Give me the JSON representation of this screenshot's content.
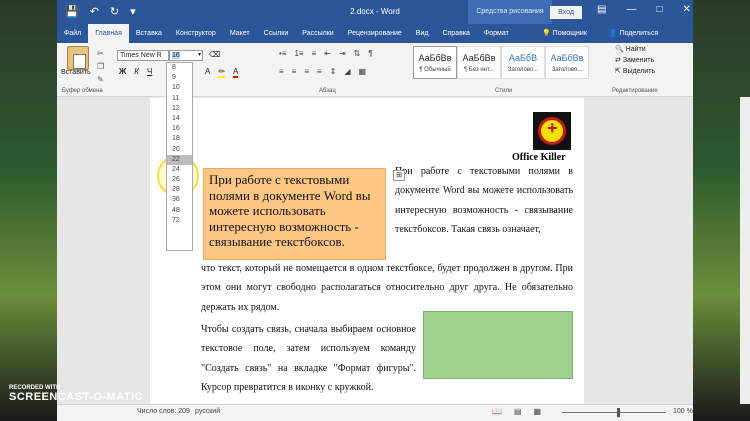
{
  "window": {
    "doc_title": "2.docx - Word",
    "context_tools": "Средства рисования",
    "login_button": "Вход",
    "qa_icons": [
      "save-icon",
      "undo-icon",
      "redo-icon"
    ]
  },
  "tabs": [
    "Файл",
    "Главная",
    "Вставка",
    "Конструктор",
    "Макет",
    "Ссылки",
    "Рассылки",
    "Рецензирование",
    "Вид",
    "Справка",
    "Формат"
  ],
  "tabs_right": {
    "assistant": "Помощник",
    "share": "Поделиться"
  },
  "ribbon": {
    "paste_label": "Вставить",
    "clipboard_group": "Буфер обмена",
    "font_name": "Times New R",
    "font_size": "16",
    "font_buttons": [
      "Ж",
      "К",
      "Ч"
    ],
    "paragraph_group": "Абзац",
    "styles_group": "Стили",
    "styles": [
      {
        "sample": "АаБбВв",
        "name": "¶ Обычный"
      },
      {
        "sample": "АаБбВв",
        "name": "¶ Без инт..."
      },
      {
        "sample": "АаБбВ",
        "name": "Заголово..."
      },
      {
        "sample": "АаБбВв",
        "name": "Заголово..."
      }
    ],
    "editing": {
      "find": "Найти",
      "replace": "Заменить",
      "select": "Выделить"
    },
    "editing_group": "Редактирование"
  },
  "font_size_dropdown": [
    "8",
    "9",
    "10",
    "11",
    "12",
    "14",
    "16",
    "18",
    "20",
    "22",
    "24",
    "26",
    "28",
    "36",
    "48",
    "72"
  ],
  "document": {
    "logo_caption": "Office Killer",
    "textbox_text": "При работе с текстовыми полями в документе Word вы можете использовать интересную возможность - связывание текстбоксов.",
    "para1_right": "При работе с текстовыми полями в документе Word вы можете использовать интересную возможность - связывание текстбоксов. Такая связь означает,",
    "para1_rest": "что текст, который не помещается в одном текстбоксе, будет продолжен в другом. При этом они могут свободно располагаться относительно друг друга. Не обязательно держать их рядом.",
    "para2": "Чтобы создать связь, сначала выбираем основное текстовое поле, затем используем команду \"Создать связь\" на вкладке \"Формат фигуры\". Курсор превратится в иконку с кружкой."
  },
  "status": {
    "words": "Число слов: 209",
    "language": "русский",
    "zoom": "100 %"
  },
  "watermark": {
    "line1": "RECORDED WITH",
    "line2": "SCREENCAST-O-MATIC"
  }
}
